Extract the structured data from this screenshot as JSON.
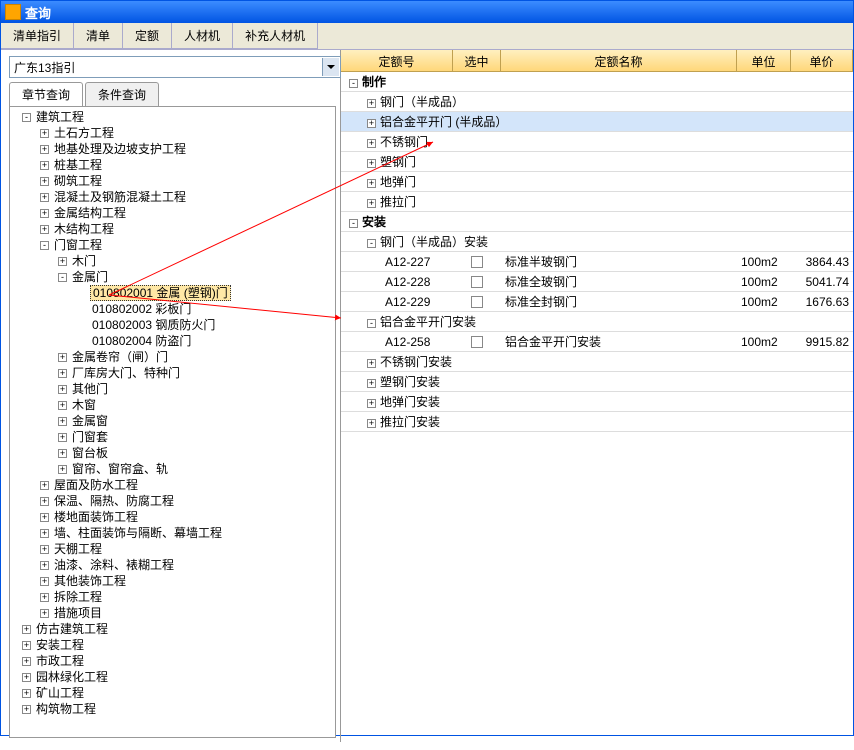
{
  "window": {
    "title": "查询",
    "icon_name": "query-app-icon"
  },
  "toolbar": {
    "buttons": [
      "清单指引",
      "清单",
      "定额",
      "人材机",
      "补充人材机"
    ]
  },
  "dropdown": {
    "value": "广东13指引"
  },
  "left_tabs": [
    "章节查询",
    "条件查询"
  ],
  "tree": [
    {
      "d": 0,
      "t": "-",
      "l": "建筑工程"
    },
    {
      "d": 1,
      "t": "+",
      "l": "土石方工程"
    },
    {
      "d": 1,
      "t": "+",
      "l": "地基处理及边坡支护工程"
    },
    {
      "d": 1,
      "t": "+",
      "l": "桩基工程"
    },
    {
      "d": 1,
      "t": "+",
      "l": "砌筑工程"
    },
    {
      "d": 1,
      "t": "+",
      "l": "混凝土及钢筋混凝土工程"
    },
    {
      "d": 1,
      "t": "+",
      "l": "金属结构工程"
    },
    {
      "d": 1,
      "t": "+",
      "l": "木结构工程"
    },
    {
      "d": 1,
      "t": "-",
      "l": "门窗工程"
    },
    {
      "d": 2,
      "t": "+",
      "l": "木门"
    },
    {
      "d": 2,
      "t": "-",
      "l": "金属门"
    },
    {
      "d": 3,
      "t": "",
      "l": "010802001   金属 (塑钢)门",
      "sel": true
    },
    {
      "d": 3,
      "t": "",
      "l": "010802002   彩板门"
    },
    {
      "d": 3,
      "t": "",
      "l": "010802003   钢质防火门"
    },
    {
      "d": 3,
      "t": "",
      "l": "010802004   防盗门"
    },
    {
      "d": 2,
      "t": "+",
      "l": "金属卷帘（闸）门"
    },
    {
      "d": 2,
      "t": "+",
      "l": "厂库房大门、特种门"
    },
    {
      "d": 2,
      "t": "+",
      "l": "其他门"
    },
    {
      "d": 2,
      "t": "+",
      "l": "木窗"
    },
    {
      "d": 2,
      "t": "+",
      "l": "金属窗"
    },
    {
      "d": 2,
      "t": "+",
      "l": "门窗套"
    },
    {
      "d": 2,
      "t": "+",
      "l": "窗台板"
    },
    {
      "d": 2,
      "t": "+",
      "l": "窗帘、窗帘盒、轨"
    },
    {
      "d": 1,
      "t": "+",
      "l": "屋面及防水工程"
    },
    {
      "d": 1,
      "t": "+",
      "l": "保温、隔热、防腐工程"
    },
    {
      "d": 1,
      "t": "+",
      "l": "楼地面装饰工程"
    },
    {
      "d": 1,
      "t": "+",
      "l": "墙、柱面装饰与隔断、幕墙工程"
    },
    {
      "d": 1,
      "t": "+",
      "l": "天棚工程"
    },
    {
      "d": 1,
      "t": "+",
      "l": "油漆、涂料、裱糊工程"
    },
    {
      "d": 1,
      "t": "+",
      "l": "其他装饰工程"
    },
    {
      "d": 1,
      "t": "+",
      "l": "拆除工程"
    },
    {
      "d": 1,
      "t": "+",
      "l": "措施项目"
    },
    {
      "d": 0,
      "t": "+",
      "l": "仿古建筑工程"
    },
    {
      "d": 0,
      "t": "+",
      "l": "安装工程"
    },
    {
      "d": 0,
      "t": "+",
      "l": "市政工程"
    },
    {
      "d": 0,
      "t": "+",
      "l": "园林绿化工程"
    },
    {
      "d": 0,
      "t": "+",
      "l": "矿山工程"
    },
    {
      "d": 0,
      "t": "+",
      "l": "构筑物工程"
    }
  ],
  "grid": {
    "headers": {
      "code": "定额号",
      "sel": "选中",
      "name": "定额名称",
      "unit": "单位",
      "price": "单价"
    },
    "rows": [
      {
        "type": "section",
        "t": "-",
        "d": 0,
        "name": "制作",
        "bold": true
      },
      {
        "type": "group",
        "t": "+",
        "d": 1,
        "name": "钢门（半成品）"
      },
      {
        "type": "group",
        "t": "+",
        "d": 1,
        "name": "铝合金平开门 (半成品）",
        "hl": true
      },
      {
        "type": "group",
        "t": "+",
        "d": 1,
        "name": "不锈钢门"
      },
      {
        "type": "group",
        "t": "+",
        "d": 1,
        "name": "塑钢门"
      },
      {
        "type": "group",
        "t": "+",
        "d": 1,
        "name": "地弹门"
      },
      {
        "type": "group",
        "t": "+",
        "d": 1,
        "name": "推拉门"
      },
      {
        "type": "section",
        "t": "-",
        "d": 0,
        "name": "安装",
        "bold": true
      },
      {
        "type": "group",
        "t": "-",
        "d": 1,
        "name": "钢门（半成品）安装"
      },
      {
        "type": "item",
        "d": 2,
        "code": "A12-227",
        "name": "标准半玻钢门",
        "unit": "100m2",
        "price": "3864.43"
      },
      {
        "type": "item",
        "d": 2,
        "code": "A12-228",
        "name": "标准全玻钢门",
        "unit": "100m2",
        "price": "5041.74"
      },
      {
        "type": "item",
        "d": 2,
        "code": "A12-229",
        "name": "标准全封钢门",
        "unit": "100m2",
        "price": "1676.63"
      },
      {
        "type": "group",
        "t": "-",
        "d": 1,
        "name": "铝合金平开门安装"
      },
      {
        "type": "item",
        "d": 2,
        "code": "A12-258",
        "name": "铝合金平开门安装",
        "unit": "100m2",
        "price": "9915.82"
      },
      {
        "type": "group",
        "t": "+",
        "d": 1,
        "name": "不锈钢门安装"
      },
      {
        "type": "group",
        "t": "+",
        "d": 1,
        "name": "塑钢门安装"
      },
      {
        "type": "group",
        "t": "+",
        "d": 1,
        "name": "地弹门安装"
      },
      {
        "type": "group",
        "t": "+",
        "d": 1,
        "name": "推拉门安装"
      }
    ]
  }
}
